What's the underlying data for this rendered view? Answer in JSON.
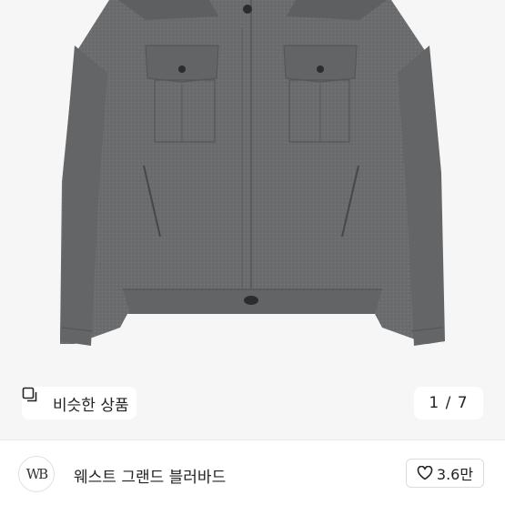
{
  "product_image": {
    "alt": "gray wool trucker jacket"
  },
  "similar_items": {
    "label": "비슷한 상품",
    "icon": "overlapping-squares-icon"
  },
  "image_counter": {
    "text": "1 / 7",
    "current": 1,
    "total": 7
  },
  "store": {
    "logo_text": "WB",
    "name": "웨스트 그랜드 블러바드"
  },
  "like": {
    "icon": "heart-outline-icon",
    "count": "3.6만"
  }
}
